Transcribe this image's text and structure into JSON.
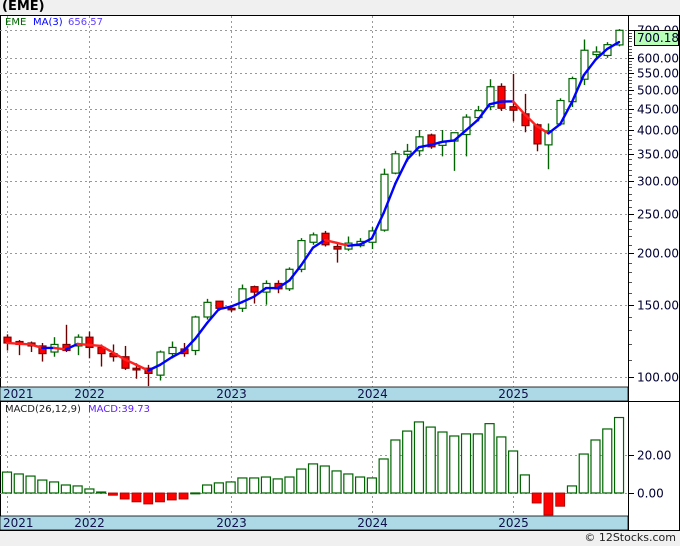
{
  "title": "(EME)",
  "footer": "© 12Stocks.com",
  "price_legend": {
    "symbol": "EME",
    "ma_label": "MA(3)",
    "ma_value": "656.57"
  },
  "macd_legend": {
    "label": "MACD(26,12,9)",
    "value": "MACD:39.73"
  },
  "last_price_tag": "700.18",
  "colors": {
    "up": "#006400",
    "down": "#ff0000",
    "ma_up": "#0000ff",
    "ma_down": "#ff2020",
    "date_band": "#add8e6",
    "price_tag": "#b8ffb8"
  },
  "chart_data": [
    {
      "type": "candlestick",
      "period": "monthly",
      "scale": "log",
      "ylim": [
        94.5,
        763
      ],
      "grid": true,
      "year_labels": [
        {
          "label": "2021",
          "index": 0
        },
        {
          "label": "2022",
          "index": 7
        },
        {
          "label": "2023",
          "index": 19
        },
        {
          "label": "2024",
          "index": 31
        },
        {
          "label": "2025",
          "index": 43
        }
      ],
      "y_ticks": [
        100,
        150,
        200,
        250,
        300,
        350,
        400,
        450,
        500,
        550,
        600,
        700
      ],
      "y_tick_labels": [
        "100.00",
        "150.00",
        "200.00",
        "250.00",
        "300.00",
        "350.00",
        "400.00",
        "450.00",
        "500.00",
        "550.00",
        "600.00",
        "700.00"
      ],
      "ma_period": 3,
      "ohlc": [
        [
          125,
          127,
          116,
          121
        ],
        [
          122,
          123,
          113,
          120
        ],
        [
          121,
          122,
          115,
          119
        ],
        [
          119,
          121,
          109,
          114
        ],
        [
          115,
          125,
          112,
          120
        ],
        [
          120,
          134,
          115,
          116
        ],
        [
          119,
          127,
          113,
          125
        ],
        [
          125,
          129,
          111,
          118
        ],
        [
          118,
          120,
          106,
          114
        ],
        [
          114,
          120,
          109,
          112
        ],
        [
          112,
          119,
          104,
          105
        ],
        [
          105,
          108,
          99,
          104
        ],
        [
          105,
          107,
          95,
          102
        ],
        [
          101,
          116,
          98,
          115
        ],
        [
          114,
          122,
          111,
          118
        ],
        [
          117,
          121,
          112,
          114
        ],
        [
          116,
          141,
          113,
          140
        ],
        [
          140,
          155,
          138,
          152
        ],
        [
          153,
          153,
          145,
          147
        ],
        [
          147,
          149,
          144,
          146
        ],
        [
          147,
          168,
          144,
          164
        ],
        [
          166,
          167,
          151,
          161
        ],
        [
          161,
          172,
          150,
          169
        ],
        [
          169,
          172,
          160,
          164
        ],
        [
          164,
          185,
          162,
          183
        ],
        [
          183,
          218,
          180,
          215
        ],
        [
          213,
          225,
          210,
          222
        ],
        [
          224,
          227,
          208,
          210
        ],
        [
          208,
          211,
          190,
          205
        ],
        [
          205,
          220,
          203,
          212
        ],
        [
          209,
          218,
          207,
          214
        ],
        [
          213,
          232,
          205,
          227
        ],
        [
          228,
          322,
          226,
          312
        ],
        [
          314,
          356,
          312,
          350
        ],
        [
          349,
          370,
          335,
          355
        ],
        [
          356,
          400,
          345,
          385
        ],
        [
          389,
          392,
          360,
          364
        ],
        [
          367,
          400,
          345,
          374
        ],
        [
          376,
          394,
          318,
          394
        ],
        [
          390,
          437,
          345,
          430
        ],
        [
          429,
          458,
          420,
          446
        ],
        [
          456,
          532,
          447,
          510
        ],
        [
          511,
          520,
          445,
          452
        ],
        [
          456,
          548,
          420,
          447
        ],
        [
          438,
          490,
          395,
          410
        ],
        [
          412,
          415,
          355,
          370
        ],
        [
          368,
          415,
          321,
          398
        ],
        [
          414,
          478,
          410,
          472
        ],
        [
          469,
          540,
          455,
          534
        ],
        [
          532,
          665,
          515,
          626
        ],
        [
          611,
          640,
          598,
          620
        ],
        [
          608,
          655,
          600,
          646
        ],
        [
          645,
          705,
          640,
          700.18
        ]
      ]
    },
    {
      "type": "bar",
      "name": "MACD(26,12,9)",
      "ylim": [
        -11.6,
        47.9
      ],
      "y_ticks": [
        0,
        20
      ],
      "y_tick_labels": [
        "0.00",
        "20.00"
      ],
      "values": [
        11.0,
        10.0,
        8.9,
        6.8,
        5.8,
        4.2,
        3.7,
        2.1,
        0.5,
        -1.2,
        -3.2,
        -4.7,
        -5.8,
        -4.7,
        -3.7,
        -3.2,
        0.0,
        4.2,
        5.3,
        5.8,
        7.9,
        7.9,
        8.4,
        7.4,
        8.4,
        12.6,
        15.3,
        14.2,
        11.6,
        10.0,
        8.4,
        7.9,
        17.9,
        27.9,
        32.6,
        37.4,
        34.7,
        32.1,
        30.0,
        31.1,
        31.1,
        36.5,
        29.5,
        22.1,
        9.5,
        -5.3,
        -11.6,
        -7.0,
        3.7,
        20.5,
        27.9,
        33.7,
        39.73
      ]
    }
  ]
}
